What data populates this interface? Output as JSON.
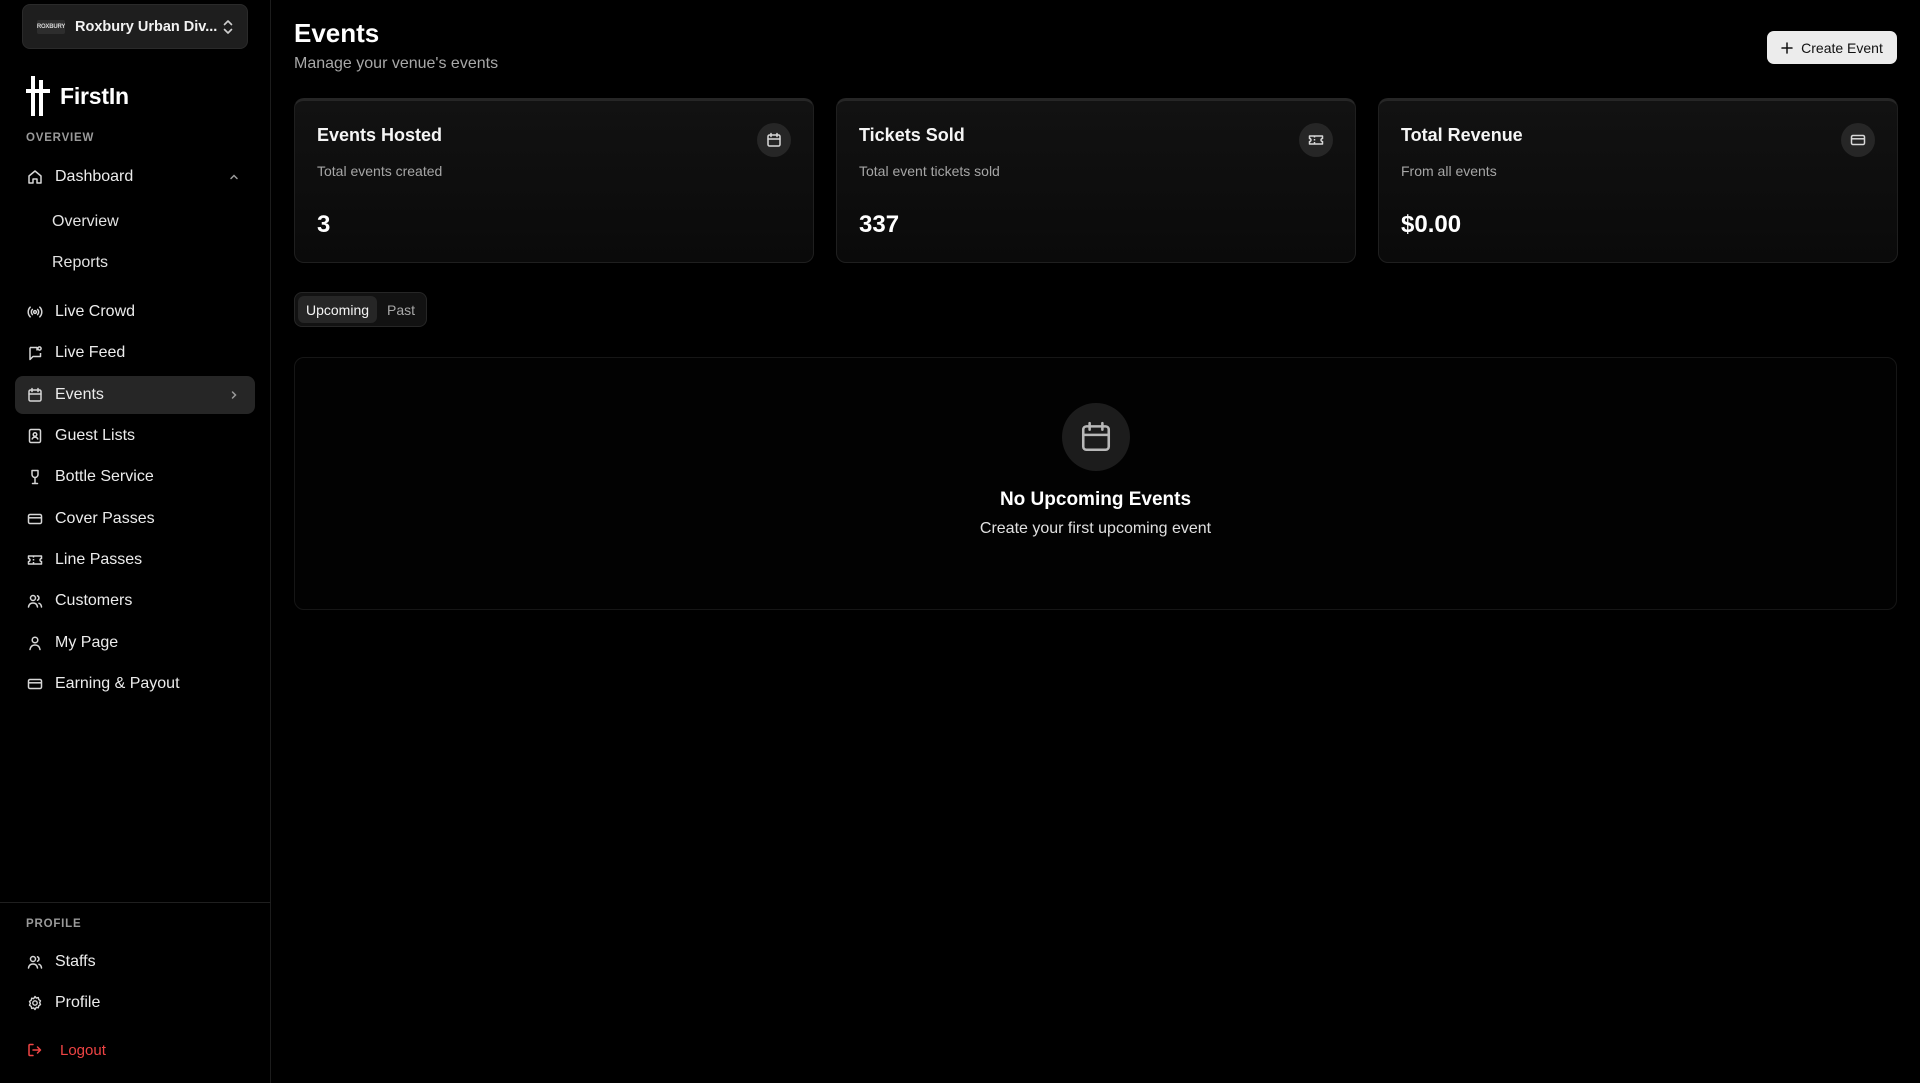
{
  "venue": {
    "logo_text": "ROXBURY",
    "name": "Roxbury Urban Div..."
  },
  "brand": {
    "name": "FirstIn"
  },
  "sidebar": {
    "overview_label": "OVERVIEW",
    "dashboard": {
      "label": "Dashboard",
      "expanded": true,
      "children": [
        "Overview",
        "Reports"
      ]
    },
    "items": [
      {
        "label": "Live Crowd",
        "icon": "broadcast-icon"
      },
      {
        "label": "Live Feed",
        "icon": "chat-square-icon"
      },
      {
        "label": "Events",
        "icon": "calendar-icon",
        "active": true
      },
      {
        "label": "Guest Lists",
        "icon": "contact-book-icon"
      },
      {
        "label": "Bottle Service",
        "icon": "wine-glass-icon"
      },
      {
        "label": "Cover Passes",
        "icon": "credit-card-icon"
      },
      {
        "label": "Line Passes",
        "icon": "ticket-icon"
      },
      {
        "label": "Customers",
        "icon": "users-icon"
      },
      {
        "label": "My Page",
        "icon": "user-icon"
      },
      {
        "label": "Earning & Payout",
        "icon": "wallet-card-icon"
      }
    ],
    "profile_label": "PROFILE",
    "profile_items": [
      {
        "label": "Staffs",
        "icon": "users-icon"
      },
      {
        "label": "Profile",
        "icon": "gear-icon"
      }
    ],
    "logout_label": "Logout"
  },
  "header": {
    "title": "Events",
    "subtitle": "Manage your venue's events",
    "create_button": "Create Event"
  },
  "stats": [
    {
      "title": "Events Hosted",
      "desc": "Total events created",
      "value": "3",
      "icon": "calendar-icon"
    },
    {
      "title": "Tickets Sold",
      "desc": "Total event tickets sold",
      "value": "337",
      "icon": "ticket-icon"
    },
    {
      "title": "Total Revenue",
      "desc": "From all events",
      "value": "$0.00",
      "icon": "credit-card-icon"
    }
  ],
  "tabs": [
    {
      "label": "Upcoming",
      "active": true
    },
    {
      "label": "Past",
      "active": false
    }
  ],
  "empty_state": {
    "title": "No Upcoming Events",
    "subtitle": "Create your first upcoming event"
  },
  "colors": {
    "background": "#000000",
    "active_item": "#262626",
    "logout": "#ef4444",
    "button_bg": "#ececec"
  }
}
